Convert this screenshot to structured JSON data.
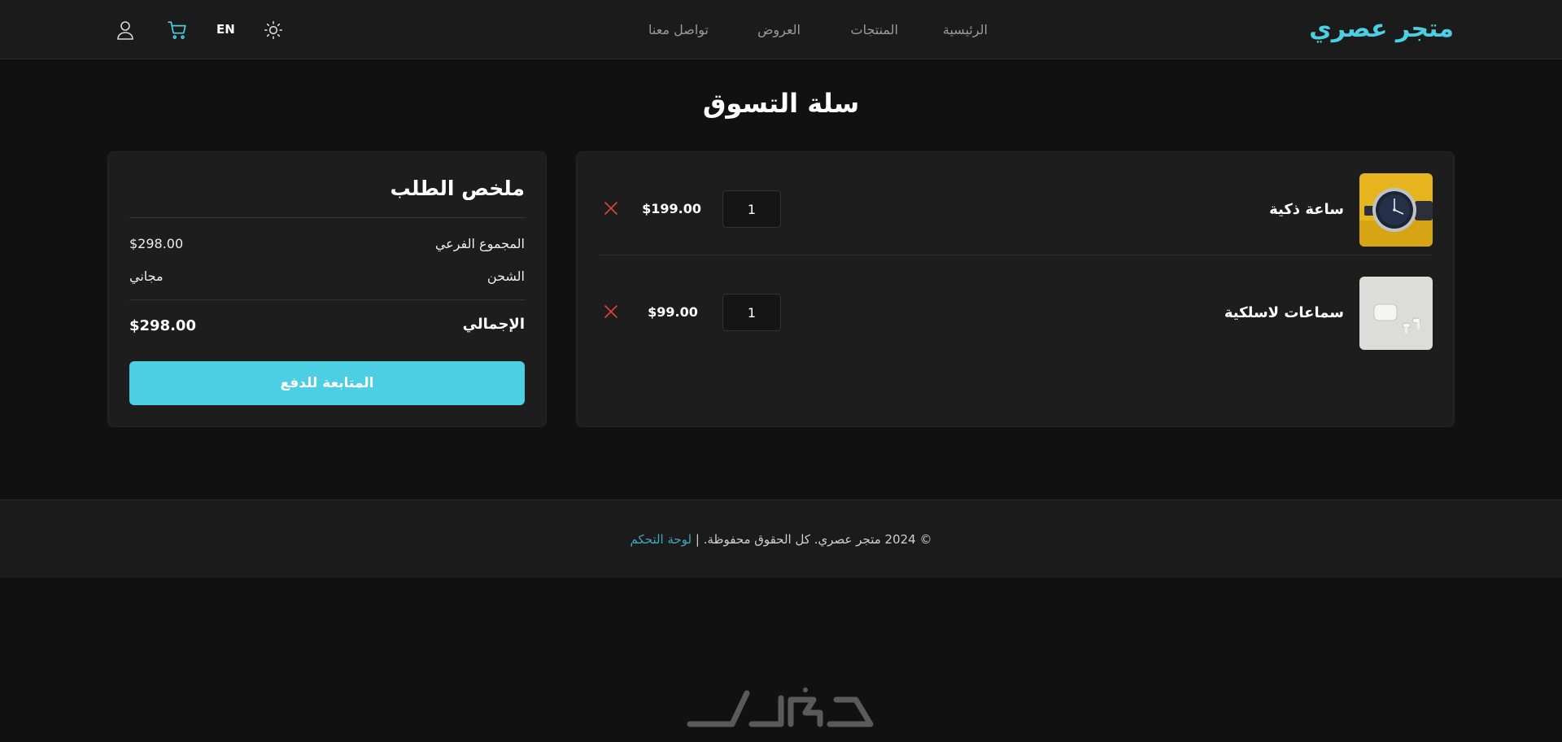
{
  "header": {
    "logo": "متجر عصري",
    "nav": [
      {
        "label": "الرئيسية"
      },
      {
        "label": "المنتجات"
      },
      {
        "label": "العروض"
      },
      {
        "label": "تواصل معنا"
      }
    ],
    "lang_label": "EN",
    "icons": {
      "theme": "sun-icon",
      "cart": "cart-icon",
      "user": "user-icon"
    }
  },
  "page": {
    "title": "سلة التسوق"
  },
  "cart": {
    "items": [
      {
        "name": "ساعة ذكية",
        "quantity": "1",
        "price": "$199.00",
        "image": "watch-image"
      },
      {
        "name": "سماعات لاسلكية",
        "quantity": "1",
        "price": "$99.00",
        "image": "earbuds-image"
      }
    ]
  },
  "summary": {
    "title": "ملخص الطلب",
    "subtotal_label": "المجموع الفرعي",
    "subtotal_value": "$298.00",
    "shipping_label": "الشحن",
    "shipping_value": "مجاني",
    "total_label": "الإجمالي",
    "total_value": "$298.00",
    "checkout_label": "المتابعة للدفع"
  },
  "footer": {
    "copyright": "© 2024 متجر عصري. كل الحقوق محفوظة. |",
    "dashboard_link": "لوحة التحكم"
  },
  "colors": {
    "accent": "#4ccfe2",
    "background": "#111111",
    "card": "#1d1d1d",
    "remove": "#e0453a"
  }
}
